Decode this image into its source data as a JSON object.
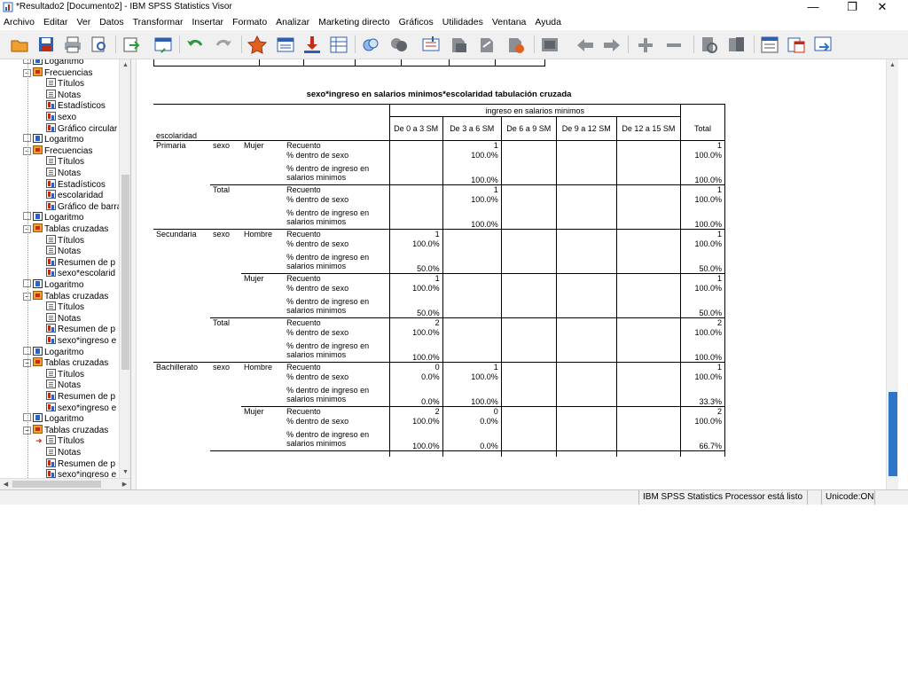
{
  "window": {
    "title": "*Resultado2 [Documento2] - IBM SPSS Statistics Visor",
    "minimize": "—",
    "restore": "❐",
    "close": "✕"
  },
  "menu": [
    "Archivo",
    "Editar",
    "Ver",
    "Datos",
    "Transformar",
    "Insertar",
    "Formato",
    "Analizar",
    "Marketing directo",
    "Gráficos",
    "Utilidades",
    "Ventana",
    "Ayuda"
  ],
  "colors": {
    "accent": "#2f76c6",
    "folder": "#f0a030",
    "red": "#c62b12"
  },
  "toolbar": {
    "icons": [
      "open-icon",
      "save-icon",
      "print-icon",
      "print-preview-icon",
      "export-icon",
      "recall-dialog-icon",
      "undo-icon",
      "redo-icon",
      "goto-data-icon",
      "goto-case-icon",
      "goto-variable-icon",
      "variables-icon",
      "custom-tables-icon",
      "split-file-icon",
      "select-cases-icon",
      "value-labels-icon",
      "show-all-icon",
      "hide-icon",
      "promote-icon",
      "demote-icon",
      "expand-icon",
      "collapse-icon",
      "show-icon",
      "insert-heading-icon",
      "insert-title-icon",
      "insert-text-icon",
      "designate-window-icon"
    ]
  },
  "nav": {
    "items": [
      {
        "label": "Logaritmo",
        "type": "book"
      },
      {
        "label": "Frecuencias",
        "type": "folder"
      },
      {
        "label": "Títulos",
        "type": "doc"
      },
      {
        "label": "Notas",
        "type": "doc"
      },
      {
        "label": "Estadísticos",
        "type": "chart"
      },
      {
        "label": "sexo",
        "type": "chart"
      },
      {
        "label": "Gráfico circular",
        "type": "chart"
      },
      {
        "label": "Logaritmo",
        "type": "book"
      },
      {
        "label": "Frecuencias",
        "type": "folder"
      },
      {
        "label": "Títulos",
        "type": "doc"
      },
      {
        "label": "Notas",
        "type": "doc"
      },
      {
        "label": "Estadísticos",
        "type": "chart"
      },
      {
        "label": "escolaridad",
        "type": "chart"
      },
      {
        "label": "Gráfico de barra",
        "type": "chart"
      },
      {
        "label": "Logaritmo",
        "type": "book"
      },
      {
        "label": "Tablas cruzadas",
        "type": "folder"
      },
      {
        "label": "Títulos",
        "type": "doc"
      },
      {
        "label": "Notas",
        "type": "doc"
      },
      {
        "label": "Resumen de p",
        "type": "chart"
      },
      {
        "label": "sexo*escolarid",
        "type": "chart"
      },
      {
        "label": "Logaritmo",
        "type": "book"
      },
      {
        "label": "Tablas cruzadas",
        "type": "folder"
      },
      {
        "label": "Títulos",
        "type": "doc"
      },
      {
        "label": "Notas",
        "type": "doc"
      },
      {
        "label": "Resumen de p",
        "type": "chart"
      },
      {
        "label": "sexo*ingreso e",
        "type": "chart"
      },
      {
        "label": "Logaritmo",
        "type": "book"
      },
      {
        "label": "Tablas cruzadas",
        "type": "folder"
      },
      {
        "label": "Títulos",
        "type": "doc"
      },
      {
        "label": "Notas",
        "type": "doc"
      },
      {
        "label": "Resumen de p",
        "type": "chart"
      },
      {
        "label": "sexo*ingreso e",
        "type": "chart"
      },
      {
        "label": "Logaritmo",
        "type": "book"
      },
      {
        "label": "Tablas cruzadas",
        "type": "folder"
      },
      {
        "label": "Títulos",
        "type": "doc"
      },
      {
        "label": "Notas",
        "type": "doc"
      },
      {
        "label": "Resumen de p",
        "type": "chart"
      },
      {
        "label": "sexo*ingreso e",
        "type": "chart"
      }
    ]
  },
  "table": {
    "title": "sexo*ingreso en salarios minimos*escolaridad tabulación cruzada",
    "group_header": "ingreso en salarios minimos",
    "row_dim_label": "escolaridad",
    "columns": [
      "De 0 a 3 SM",
      "De 3 a 6 SM",
      "De 6 a 9 SM",
      "De 9 a 12 SM",
      "De 12 a 15 SM",
      "Total"
    ],
    "stat_labels": {
      "count": "Recuento",
      "pct_sexo": "% dentro de sexo",
      "pct_ingreso": "% dentro de ingreso en salarios minimos"
    },
    "groups": [
      {
        "escolaridad": "Primaria",
        "blocks": [
          {
            "dim": "sexo",
            "level": "Mujer",
            "rows": [
              [
                "",
                "1",
                "",
                "",
                "",
                "1"
              ],
              [
                "",
                "100.0%",
                "",
                "",
                "",
                "100.0%"
              ],
              [
                "",
                "100.0%",
                "",
                "",
                "",
                "100.0%"
              ]
            ]
          },
          {
            "dim": "Total",
            "level": "",
            "rows": [
              [
                "",
                "1",
                "",
                "",
                "",
                "1"
              ],
              [
                "",
                "100.0%",
                "",
                "",
                "",
                "100.0%"
              ],
              [
                "",
                "100.0%",
                "",
                "",
                "",
                "100.0%"
              ]
            ]
          }
        ]
      },
      {
        "escolaridad": "Secundaria",
        "blocks": [
          {
            "dim": "sexo",
            "level": "Hombre",
            "rows": [
              [
                "1",
                "",
                "",
                "",
                "",
                "1"
              ],
              [
                "100.0%",
                "",
                "",
                "",
                "",
                "100.0%"
              ],
              [
                "50.0%",
                "",
                "",
                "",
                "",
                "50.0%"
              ]
            ]
          },
          {
            "dim": "",
            "level": "Mujer",
            "rows": [
              [
                "1",
                "",
                "",
                "",
                "",
                "1"
              ],
              [
                "100.0%",
                "",
                "",
                "",
                "",
                "100.0%"
              ],
              [
                "50.0%",
                "",
                "",
                "",
                "",
                "50.0%"
              ]
            ]
          },
          {
            "dim": "Total",
            "level": "",
            "rows": [
              [
                "2",
                "",
                "",
                "",
                "",
                "2"
              ],
              [
                "100.0%",
                "",
                "",
                "",
                "",
                "100.0%"
              ],
              [
                "100.0%",
                "",
                "",
                "",
                "",
                "100.0%"
              ]
            ]
          }
        ]
      },
      {
        "escolaridad": "Bachillerato",
        "blocks": [
          {
            "dim": "sexo",
            "level": "Hombre",
            "rows": [
              [
                "0",
                "1",
                "",
                "",
                "",
                "1"
              ],
              [
                "0.0%",
                "100.0%",
                "",
                "",
                "",
                "100.0%"
              ],
              [
                "0.0%",
                "100.0%",
                "",
                "",
                "",
                "33.3%"
              ]
            ]
          },
          {
            "dim": "",
            "level": "Mujer",
            "rows": [
              [
                "2",
                "0",
                "",
                "",
                "",
                "2"
              ],
              [
                "100.0%",
                "0.0%",
                "",
                "",
                "",
                "100.0%"
              ],
              [
                "100.0%",
                "0.0%",
                "",
                "",
                "",
                "66.7%"
              ]
            ]
          }
        ]
      }
    ]
  },
  "status": {
    "processor": "IBM SPSS Statistics Processor está listo",
    "unicode": "Unicode:ON"
  }
}
